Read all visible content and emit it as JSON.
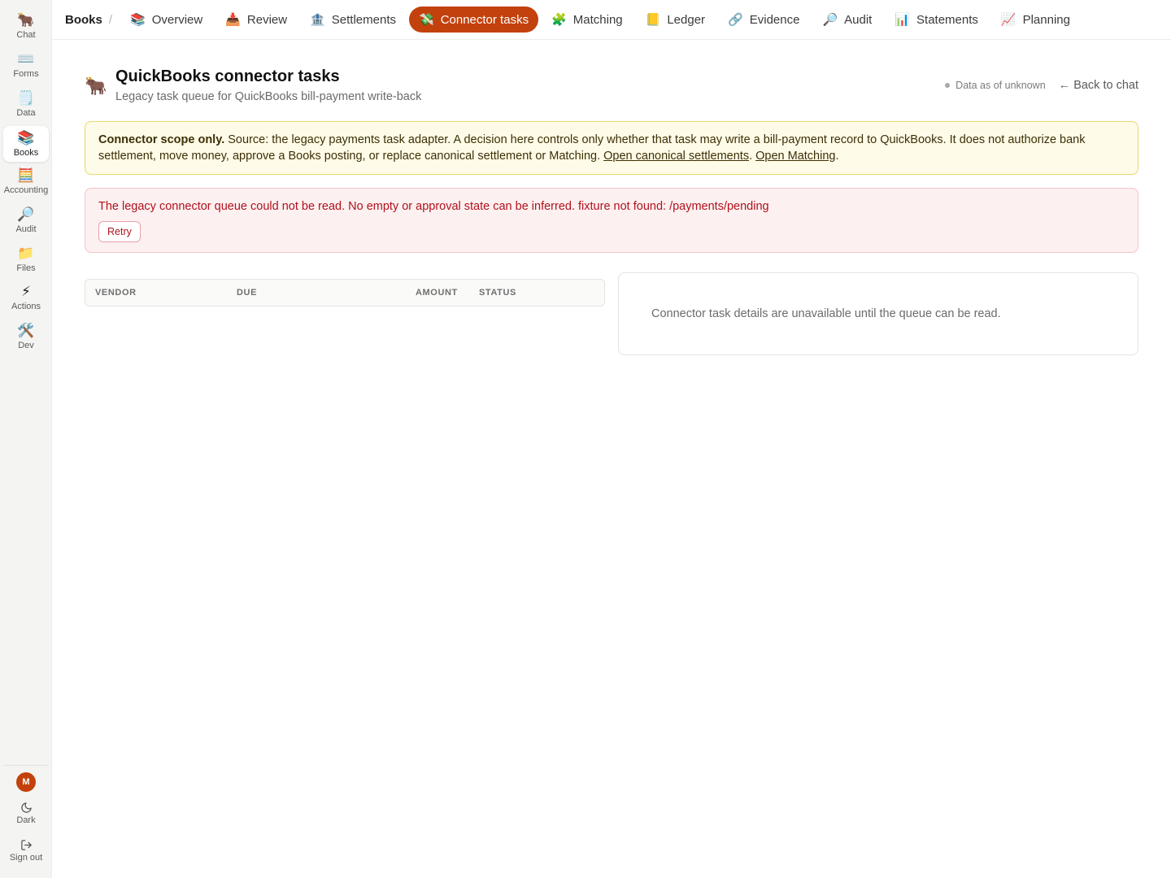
{
  "rail": {
    "items": [
      {
        "icon": "🐂",
        "label": "Chat"
      },
      {
        "icon": "⌨️",
        "label": "Forms"
      },
      {
        "icon": "🗒️",
        "label": "Data"
      },
      {
        "icon": "📚",
        "label": "Books"
      },
      {
        "icon": "🧮",
        "label": "Accounting"
      },
      {
        "icon": "🔎",
        "label": "Audit"
      },
      {
        "icon": "📁",
        "label": "Files"
      },
      {
        "icon": "⚡",
        "label": "Actions"
      },
      {
        "icon": "🛠️",
        "label": "Dev"
      }
    ],
    "active": "Books",
    "avatar_initial": "M",
    "dark_label": "Dark",
    "signout_label": "Sign out"
  },
  "topnav": {
    "breadcrumb": "Books",
    "separator": "/",
    "tabs": [
      {
        "icon": "📚",
        "label": "Overview"
      },
      {
        "icon": "📥",
        "label": "Review"
      },
      {
        "icon": "🏦",
        "label": "Settlements"
      },
      {
        "icon": "💸",
        "label": "Connector tasks"
      },
      {
        "icon": "🧩",
        "label": "Matching"
      },
      {
        "icon": "📒",
        "label": "Ledger"
      },
      {
        "icon": "🔗",
        "label": "Evidence"
      },
      {
        "icon": "🔎",
        "label": "Audit"
      },
      {
        "icon": "📊",
        "label": "Statements"
      },
      {
        "icon": "📈",
        "label": "Planning"
      }
    ],
    "active_tab": "Connector tasks",
    "accent_color": "#c2410c"
  },
  "header": {
    "icon": "🐂",
    "title": "QuickBooks connector tasks",
    "subtitle": "Legacy task queue for QuickBooks bill-payment write-back",
    "data_as_of": "Data as of unknown",
    "back_link": "← Back to chat"
  },
  "notice": {
    "bold": "Connector scope only.",
    "text": " Source: the legacy payments task adapter. A decision here controls only whether that task may write a bill-payment record to QuickBooks. It does not authorize bank settlement, move money, approve a Books posting, or replace canonical settlement or Matching. ",
    "link1": "Open canonical settlements",
    "between": ". ",
    "link2": "Open Matching",
    "end": "."
  },
  "error": {
    "message": "The legacy connector queue could not be read. No empty or approval state can be inferred. fixture not found: /payments/pending",
    "retry_label": "Retry"
  },
  "table": {
    "columns": [
      "VENDOR",
      "DUE",
      "AMOUNT",
      "STATUS"
    ]
  },
  "detail": {
    "message": "Connector task details are unavailable until the queue can be read."
  }
}
